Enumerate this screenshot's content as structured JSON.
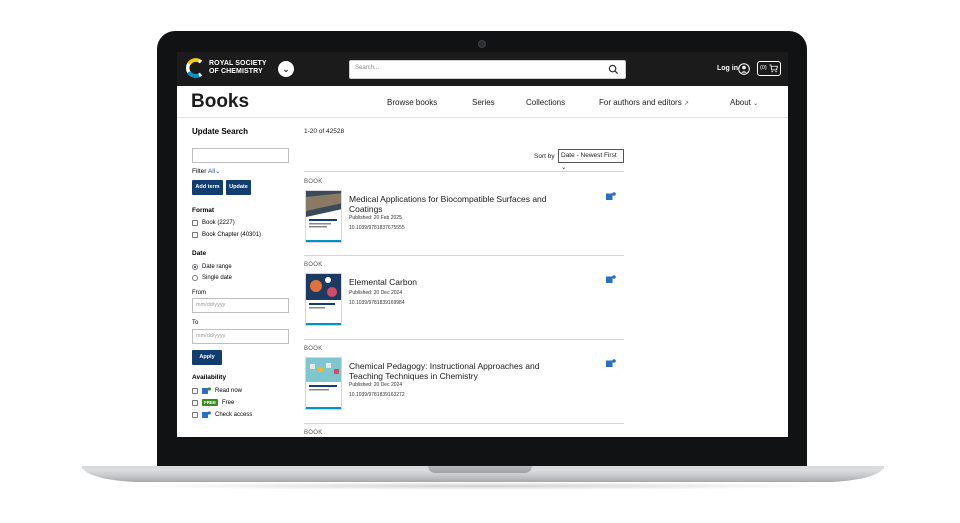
{
  "header": {
    "logo_line1": "ROYAL SOCIETY",
    "logo_line2": "OF CHEMISTRY",
    "search_placeholder": "Search...",
    "login_label": "Log in",
    "cart_count": "(0)"
  },
  "title": "Books",
  "nav": [
    "Browse books",
    "Series",
    "Collections",
    "For authors and editors",
    "About"
  ],
  "sidebar": {
    "heading": "Update Search",
    "filter_label": "Filter",
    "filter_value": "All",
    "add_term": "Add term",
    "update": "Update",
    "format_heading": "Format",
    "format_options": [
      "Book (2227)",
      "Book Chapter (40301)"
    ],
    "date_heading": "Date",
    "date_options": [
      "Date range",
      "Single date"
    ],
    "from_label": "From",
    "to_label": "To",
    "date_placeholder": "mm/dd/yyyy",
    "apply": "Apply",
    "availability_heading": "Availability",
    "availability_options": [
      "Read now",
      "Free",
      "Check access"
    ],
    "free_badge": "FREE"
  },
  "results": {
    "count": "1-20 of 42528",
    "sort_label": "Sort by",
    "sort_value": "Date - Newest First",
    "items": [
      {
        "kind": "BOOK",
        "title": "Medical Applications for Biocompatible Surfaces and Coatings",
        "published": "Published: 20 Feb 2025",
        "doi": "10.1039/9781837675555"
      },
      {
        "kind": "BOOK",
        "title": "Elemental Carbon",
        "published": "Published: 20 Dec 2024",
        "doi": "10.1039/9781839169984"
      },
      {
        "kind": "BOOK",
        "title": "Chemical Pedagogy: Instructional Approaches and Teaching Techniques in Chemistry",
        "published": "Published: 20 Dec 2024",
        "doi": "10.1039/9781839163272"
      },
      {
        "kind": "BOOK"
      }
    ]
  },
  "colors": {
    "brand_navy": "#123d6f",
    "header_bg": "#1b1b1b"
  }
}
